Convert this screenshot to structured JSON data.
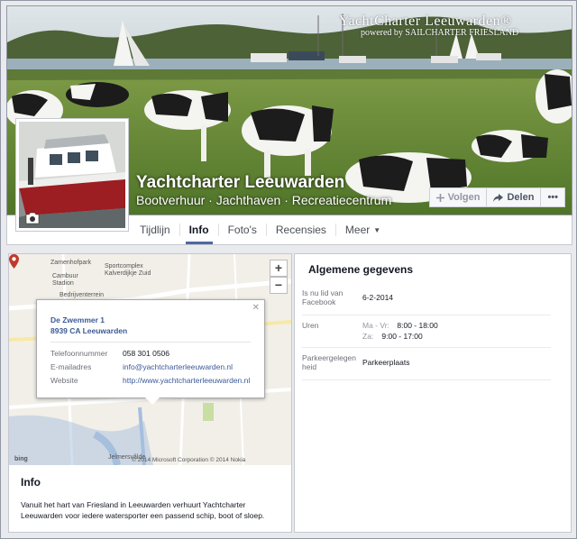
{
  "cover": {
    "brand_title": "YachtCharter Leeuwarden®",
    "brand_subtitle": "powered by SAILCHARTER FRIESLAND",
    "page_name": "Yachtcharter Leeuwarden",
    "categories": "Bootverhuur · Jachthaven · Recreatiecentrum",
    "actions": {
      "follow": "Volgen",
      "share": "Delen",
      "more": "•••"
    }
  },
  "nav": {
    "items": [
      {
        "label": "Tijdlijn"
      },
      {
        "label": "Info",
        "active": true
      },
      {
        "label": "Foto's"
      },
      {
        "label": "Recensies"
      },
      {
        "label": "Meer"
      }
    ]
  },
  "map": {
    "zoom_in": "+",
    "zoom_out": "−",
    "labels": [
      "Zamenhofpark",
      "Sportcomplex Kalverdijkje Zuid",
      "Cambuur Stadion",
      "Bedrijventerrein",
      "Jelmersvâlde"
    ],
    "attribution": "bing",
    "copyright": "© 2014 Microsoft Corporation   © 2014 Nokia",
    "popup": {
      "close": "✕",
      "street": "De Zwemmer 1",
      "postal": "8939 CA Leeuwarden",
      "rows": [
        {
          "label": "Telefoonnummer",
          "value": "058 301 0506"
        },
        {
          "label": "E-mailadres",
          "value": "info@yachtcharterleeuwarden.nl"
        },
        {
          "label": "Website",
          "value": "http://www.yachtcharterleeuwarden.nl"
        }
      ]
    }
  },
  "info": {
    "title": "Info",
    "text": "Vanuit het hart van Friesland in Leeuwarden verhuurt Yachtcharter Leeuwarden voor iedere watersporter een passend schip, boot of sloep."
  },
  "general": {
    "title": "Algemene gegevens",
    "member_label": "Is nu lid van Facebook",
    "member_value": "6-2-2014",
    "hours_label": "Uren",
    "hours": [
      {
        "days": "Ma - Vr:",
        "time": "8:00 - 18:00"
      },
      {
        "days": "Za:",
        "time": "9:00 - 17:00"
      }
    ],
    "parking_label": "Parkeergelegen heid",
    "parking_value": "Parkeerplaats"
  },
  "colors": {
    "link": "#3b5998",
    "tab_underline": "#4e69a2",
    "pin": "#c0392b"
  }
}
